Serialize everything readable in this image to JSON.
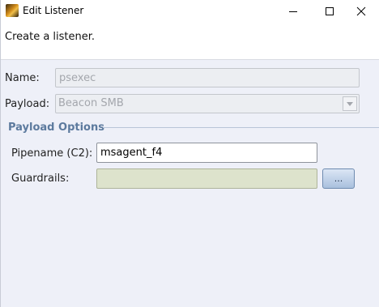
{
  "window": {
    "title": "Edit Listener"
  },
  "header": {
    "description": "Create a listener."
  },
  "form": {
    "name_label": "Name:",
    "name_value": "psexec",
    "payload_label": "Payload:",
    "payload_value": "Beacon SMB"
  },
  "payload_options": {
    "group_title": "Payload Options",
    "pipename_label": "Pipename (C2):",
    "pipename_value": "msagent_f4",
    "guardrails_label": "Guardrails:",
    "guardrails_value": "",
    "browse_label": "..."
  },
  "icons": {
    "app": "cobalt-strike-app-icon",
    "minimize": "minimize-icon",
    "maximize": "maximize-icon",
    "close": "close-icon",
    "dropdown": "chevron-down-icon"
  },
  "colors": {
    "window_bg": "#eef0f8",
    "group_title": "#5c7a9e",
    "guardrails_bg": "#dde3cc"
  }
}
